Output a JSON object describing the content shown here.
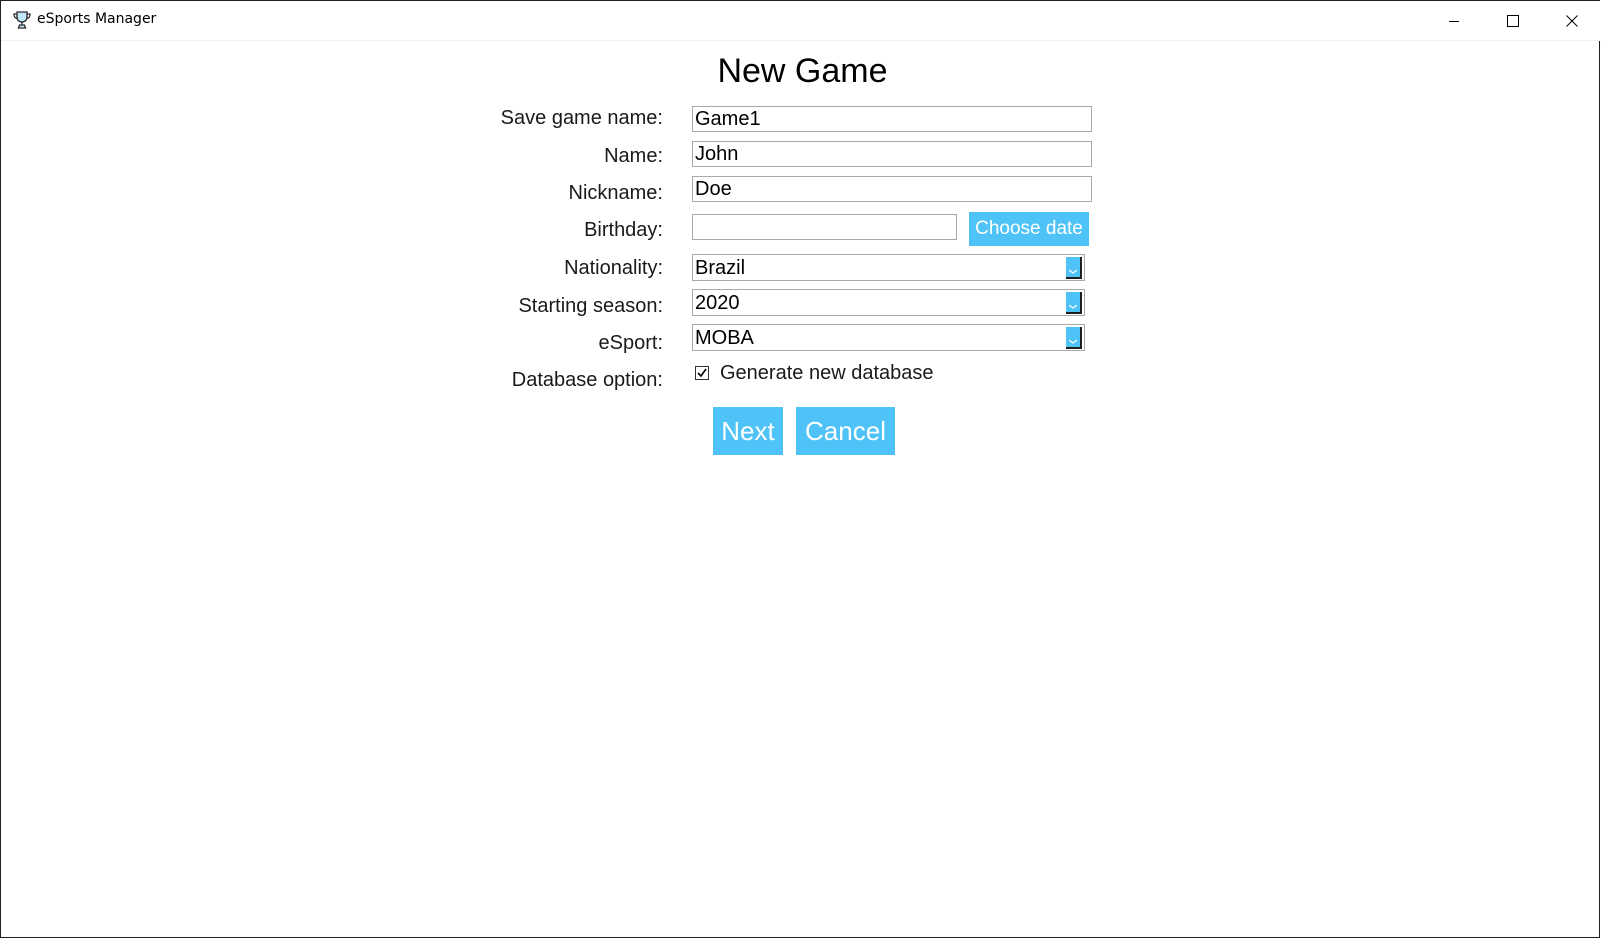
{
  "window": {
    "title": "eSports Manager",
    "app_icon": "trophy-icon",
    "controls": [
      "minimize-icon",
      "maximize-icon",
      "close-icon"
    ]
  },
  "form": {
    "heading": "New Game",
    "fields": {
      "save_game_name": {
        "label": "Save game name:",
        "value": "Game1"
      },
      "name": {
        "label": "Name:",
        "value": "John"
      },
      "nickname": {
        "label": "Nickname:",
        "value": "Doe"
      },
      "birthday": {
        "label": "Birthday:",
        "value": "",
        "button_label": "Choose date"
      },
      "nationality": {
        "label": "Nationality:",
        "value": "Brazil"
      },
      "starting_season": {
        "label": "Starting season:",
        "value": "2020"
      },
      "esport": {
        "label": "eSport:",
        "value": "MOBA"
      },
      "database_option": {
        "label": "Database option:",
        "checkbox_label": "Generate new database",
        "checked": true
      }
    },
    "buttons": {
      "next": "Next",
      "cancel": "Cancel"
    }
  },
  "colors": {
    "accent": "#4fc3f7",
    "border": "#a9a9a9",
    "text": "#1a1a1a"
  }
}
